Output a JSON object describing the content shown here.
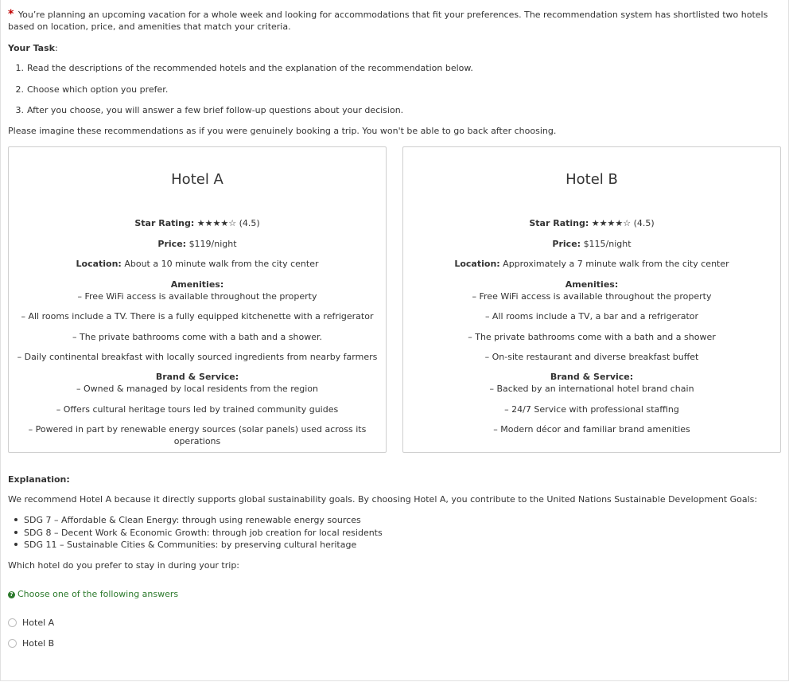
{
  "intro": {
    "asterisk": "*",
    "text": "You’re planning an upcoming vacation for a whole week and looking for accommodations that fit your preferences. The recommendation system has shortlisted two hotels based on location, price, and amenities that match your criteria."
  },
  "task": {
    "heading": "Your Task",
    "heading_suffix": ":",
    "steps": [
      {
        "num": "1.",
        "text": "Read the descriptions of the recommended hotels and the explanation of the recommendation below."
      },
      {
        "num": "2.",
        "text": "Choose which option you prefer."
      },
      {
        "num": "3.",
        "text": "After you choose, you will answer a few brief follow-up questions about your decision."
      }
    ]
  },
  "imagine": "Please imagine these recommendations as if you were genuinely booking a trip. You won't be able to go back after choosing.",
  "labels": {
    "star_rating": "Star Rating:",
    "price": "Price:",
    "location": "Location:",
    "amenities": "Amenities:",
    "brand": "Brand & Service:"
  },
  "hotels": [
    {
      "name": "Hotel A",
      "stars": "★★★★☆",
      "rating": "(4.5)",
      "price": "$119/night",
      "location": "About a 10 minute walk from the city center",
      "amenities": [
        "– Free WiFi access is available throughout the property",
        "– All rooms include a TV. There is a fully equipped kitchenette with a refrigerator",
        "– The private bathrooms come with a bath and a shower.",
        "– Daily continental breakfast with locally sourced ingredients from nearby farmers"
      ],
      "brand": [
        "– Owned & managed by local residents from the region",
        "– Offers cultural heritage tours led by trained community guides",
        "– Powered in part by renewable energy sources (solar panels) used across its operations"
      ]
    },
    {
      "name": "Hotel B",
      "stars": "★★★★☆",
      "rating": "(4.5)",
      "price": "$115/night",
      "location": "Approximately a 7 minute walk from the city center",
      "amenities": [
        "– Free WiFi access is available throughout the property",
        "– All rooms include a TV, a bar and a refrigerator",
        "– The private bathrooms come with a bath and a shower",
        "– On-site restaurant and diverse breakfast buffet"
      ],
      "brand": [
        "– Backed by an international hotel brand chain",
        "– 24/7 Service with professional staffing",
        "– Modern décor and familiar brand amenities"
      ]
    }
  ],
  "explanation": {
    "heading": "Explanation:",
    "text": "We recommend Hotel A because it directly supports global sustainability goals. By choosing Hotel A, you contribute to the United Nations Sustainable Development Goals:",
    "sdgs": [
      "SDG 7 – Affordable & Clean Energy: through using renewable energy sources",
      "SDG 8 – Decent Work & Economic Growth: through job creation for local residents",
      "SDG 11 – Sustainable Cities & Communities: by preserving cultural heritage"
    ]
  },
  "question": "Which hotel do you prefer to stay in during your trip:",
  "hint": {
    "icon": "question-circle-icon",
    "icon_glyph": "?",
    "text": "Choose one of the following answers"
  },
  "options": [
    "Hotel A",
    "Hotel B"
  ],
  "colors": {
    "required": "#c00000",
    "hint": "#2c7a2c",
    "card_border": "#cfcfcf",
    "text": "#333333"
  }
}
